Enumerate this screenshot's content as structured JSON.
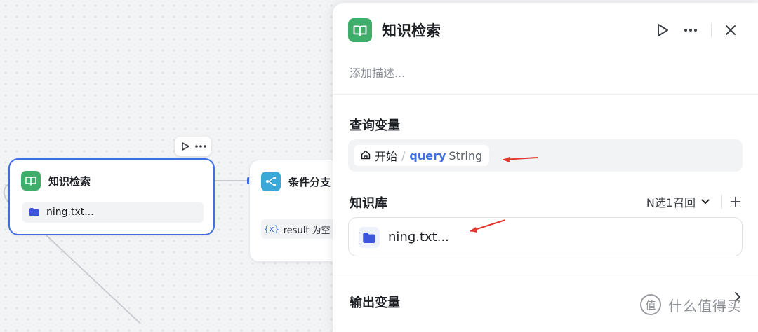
{
  "canvas": {
    "kb_node": {
      "title": "知识检索",
      "item": "ning.txt...",
      "icon": "book-icon",
      "accent": "#3f6fe0"
    },
    "cond_node": {
      "title": "条件分支",
      "var_tag": "{x}",
      "condition": "result 为空",
      "icon": "branch-icon"
    },
    "toolbar": {
      "icons": [
        "play-icon",
        "more-icon"
      ]
    }
  },
  "panel": {
    "title": "知识检索",
    "description_placeholder": "添加描述...",
    "actions": [
      "play-icon",
      "more-icon",
      "close-icon"
    ],
    "query_section": {
      "label": "查询变量",
      "source": "开始",
      "separator": "/",
      "variable": "query",
      "type": "String"
    },
    "kb_section": {
      "label": "知识库",
      "recall_mode": "N选1召回",
      "item": "ning.txt..."
    },
    "output_section": {
      "label": "输出变量"
    }
  },
  "watermark": {
    "logo": "值",
    "text": "什么值得买"
  },
  "colors": {
    "node_green": "#3fae6b",
    "branch_blue": "#3aa8d8",
    "selected_border": "#3f6fe0",
    "annotation_red": "#e5362d"
  }
}
